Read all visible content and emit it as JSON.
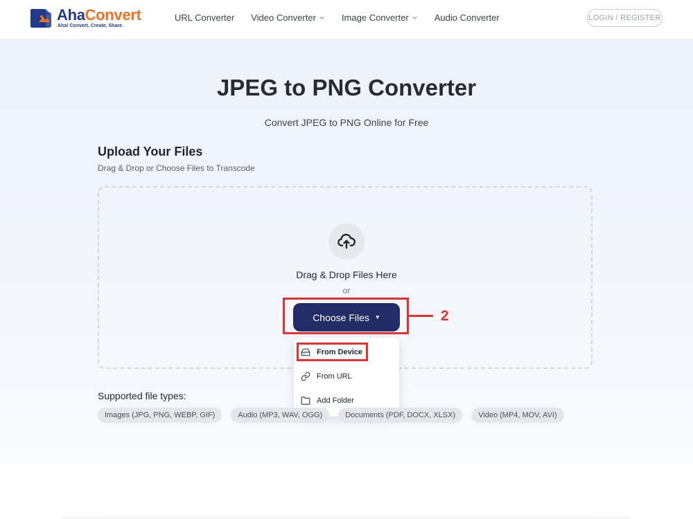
{
  "header": {
    "logo": {
      "brand_part1": "Aha",
      "brand_part2": "Convert",
      "tagline": "Aha! Convert, Create, Share."
    },
    "nav": [
      {
        "label": "URL Converter",
        "has_dropdown": false
      },
      {
        "label": "Video Converter",
        "has_dropdown": true
      },
      {
        "label": "Image Converter",
        "has_dropdown": true
      },
      {
        "label": "Audio Converter",
        "has_dropdown": false
      }
    ],
    "login_label": "LOGIN / REGISTER"
  },
  "main": {
    "title": "JPEG to PNG Converter",
    "subtitle": "Convert JPEG to PNG Online for Free",
    "upload": {
      "heading": "Upload Your Files",
      "subheading": "Drag & Drop or Choose Files to Transcode",
      "drop_text": "Drag & Drop Files Here",
      "or_text": "or",
      "choose_label": "Choose Files",
      "menu": [
        {
          "label": "From Device",
          "icon": "hard-drive-icon"
        },
        {
          "label": "From URL",
          "icon": "link-icon"
        },
        {
          "label": "Add Folder",
          "icon": "folder-icon"
        }
      ]
    },
    "supported": {
      "label": "Supported file types:",
      "chips": [
        "Images (JPG, PNG, WEBP, GIF)",
        "Audio (MP3, WAV, OGG)",
        "Documents (PDF, DOCX, XLSX)",
        "Video (MP4, MOV, AVI)"
      ]
    }
  },
  "annotation": {
    "step_number": "2",
    "color": "#e8302f"
  },
  "colors": {
    "primary_button": "#232c66",
    "brand_blue": "#1f3a8a",
    "brand_orange": "#f0711f"
  }
}
